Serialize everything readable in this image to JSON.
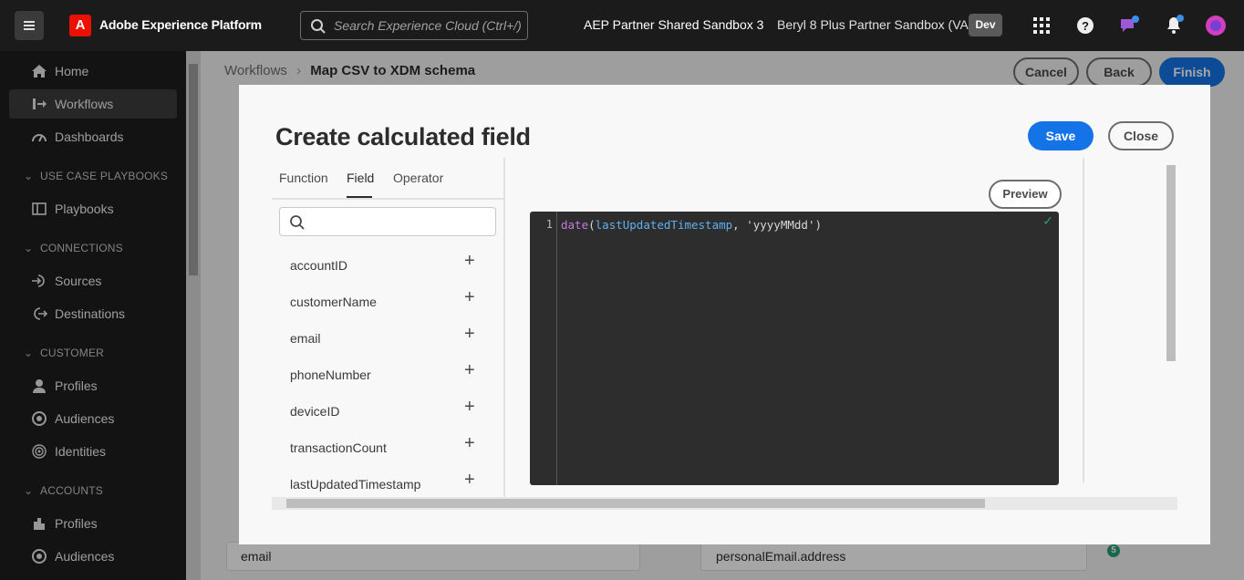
{
  "topbar": {
    "app_title": "Adobe Experience Platform",
    "search_placeholder": "Search Experience Cloud (Ctrl+/)",
    "org": "AEP Partner Shared Sandbox 3",
    "sandbox": "Beryl 8 Plus Partner Sandbox (VA7)",
    "env_badge": "Dev"
  },
  "sidebar": {
    "items": [
      {
        "label": "Home",
        "icon": "home-icon"
      },
      {
        "label": "Workflows",
        "icon": "workflows-icon"
      },
      {
        "label": "Dashboards",
        "icon": "dashboards-icon"
      },
      {
        "label": "Playbooks",
        "icon": "playbooks-icon"
      },
      {
        "label": "Sources",
        "icon": "sources-icon"
      },
      {
        "label": "Destinations",
        "icon": "destinations-icon"
      },
      {
        "label": "Profiles",
        "icon": "profiles-icon"
      },
      {
        "label": "Audiences",
        "icon": "audiences-icon"
      },
      {
        "label": "Identities",
        "icon": "identities-icon"
      },
      {
        "label": "Profiles",
        "icon": "profiles-icon"
      },
      {
        "label": "Audiences",
        "icon": "audiences-icon"
      }
    ],
    "sections": [
      "USE CASE PLAYBOOKS",
      "CONNECTIONS",
      "CUSTOMER",
      "ACCOUNTS"
    ]
  },
  "main": {
    "breadcrumb_root": "Workflows",
    "breadcrumb_current": "Map CSV to XDM schema",
    "cancel": "Cancel",
    "back": "Back",
    "finish": "Finish",
    "source_field": "email",
    "target_field": "personalEmail.address",
    "suggestion_count": "5"
  },
  "modal": {
    "title": "Create calculated field",
    "save": "Save",
    "close": "Close",
    "tabs": [
      "Function",
      "Field",
      "Operator"
    ],
    "active_tab": "Field",
    "fields": [
      "accountID",
      "customerName",
      "email",
      "phoneNumber",
      "deviceID",
      "transactionCount",
      "lastUpdatedTimestamp"
    ],
    "preview": "Preview",
    "line_number": "1",
    "code": {
      "fn": "date",
      "open": "(",
      "arg": "lastUpdatedTimestamp",
      "rest": ", 'yyyyMMdd')"
    }
  }
}
